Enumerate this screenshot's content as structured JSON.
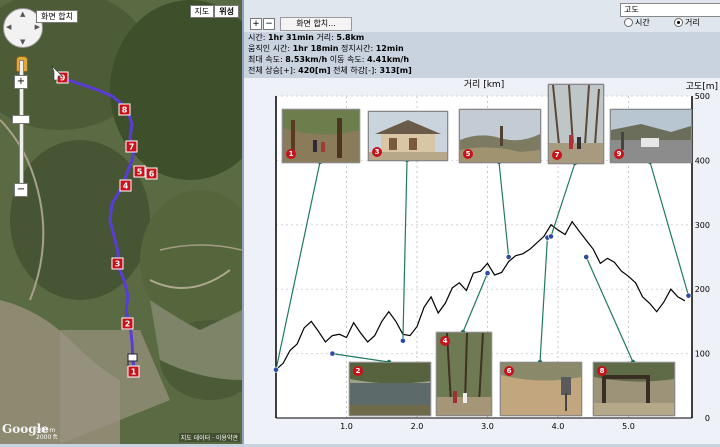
{
  "map": {
    "merge_button": "화면 합치",
    "type_map": "지도",
    "type_satellite": "위성",
    "logo": "Google",
    "scale_top": "500 m",
    "scale_bottom": "2000 ft",
    "attribution": "지도 데이터 · 이용약관",
    "markers": [
      "9",
      "8",
      "7",
      "6",
      "5",
      "4",
      "3",
      "2",
      "1"
    ]
  },
  "toolbar": {
    "plus": "+",
    "minus": "−",
    "merge_button": "화면 합치...",
    "series_select": "고도",
    "radio_time": "시간",
    "radio_distance": "거리",
    "radio_selected": "거리"
  },
  "stats": {
    "line1": [
      "시간: ",
      "1hr 31min",
      "  거리: ",
      "5.8km"
    ],
    "line2": [
      "움직인 시간: ",
      "1hr 18min",
      "  정지시간: ",
      "12min"
    ],
    "line3": [
      "최대 속도: ",
      "8.53km/h",
      "  이동 속도: ",
      "4.41km/h"
    ],
    "line4": [
      "전체 상승[+]: ",
      "420[m]",
      "  전체 하강[-]: ",
      "313[m]"
    ]
  },
  "chart_data": {
    "type": "line",
    "xlabel": "거리 [km]",
    "ylabel": "고도[m]",
    "x_ticks": [
      "1.0",
      "2.0",
      "3.0",
      "4.0",
      "5.0"
    ],
    "y_ticks": [
      "0",
      "100",
      "200",
      "300",
      "400",
      "500"
    ],
    "xlim": [
      0,
      5.9
    ],
    "ylim": [
      0,
      500
    ],
    "grid": true,
    "series": [
      {
        "name": "고도",
        "x": [
          0.0,
          0.1,
          0.2,
          0.3,
          0.4,
          0.5,
          0.6,
          0.7,
          0.8,
          0.9,
          1.0,
          1.1,
          1.2,
          1.3,
          1.4,
          1.5,
          1.6,
          1.7,
          1.8,
          1.9,
          2.0,
          2.1,
          2.2,
          2.3,
          2.4,
          2.5,
          2.6,
          2.7,
          2.8,
          2.9,
          3.0,
          3.1,
          3.2,
          3.3,
          3.4,
          3.5,
          3.6,
          3.7,
          3.8,
          3.9,
          4.0,
          4.1,
          4.2,
          4.3,
          4.4,
          4.5,
          4.6,
          4.7,
          4.8,
          4.9,
          5.0,
          5.1,
          5.2,
          5.3,
          5.4,
          5.5,
          5.6,
          5.7,
          5.8
        ],
        "y": [
          75,
          85,
          105,
          115,
          140,
          150,
          135,
          118,
          128,
          130,
          125,
          148,
          132,
          118,
          128,
          150,
          165,
          150,
          130,
          128,
          142,
          172,
          188,
          163,
          178,
          202,
          210,
          198,
          225,
          228,
          240,
          222,
          226,
          243,
          252,
          255,
          262,
          272,
          282,
          300,
          292,
          285,
          305,
          290,
          276,
          262,
          240,
          248,
          242,
          228,
          220,
          210,
          188,
          178,
          165,
          180,
          200,
          188,
          182
        ],
        "photo_points": [
          {
            "n": "1",
            "x": 0.0,
            "y": 75
          },
          {
            "n": "2",
            "x": 0.8,
            "y": 100
          },
          {
            "n": "3",
            "x": 1.8,
            "y": 120
          },
          {
            "n": "4",
            "x": 3.0,
            "y": 225
          },
          {
            "n": "5",
            "x": 3.3,
            "y": 250
          },
          {
            "n": "6",
            "x": 3.85,
            "y": 280
          },
          {
            "n": "7",
            "x": 3.9,
            "y": 282
          },
          {
            "n": "8",
            "x": 4.4,
            "y": 250
          },
          {
            "n": "9",
            "x": 5.85,
            "y": 190
          }
        ]
      }
    ]
  },
  "photos": [
    {
      "n": "1",
      "desc": "hikers on trail"
    },
    {
      "n": "3",
      "desc": "traditional house"
    },
    {
      "n": "5",
      "desc": "mountain view"
    },
    {
      "n": "7",
      "desc": "hikers under trees"
    },
    {
      "n": "9",
      "desc": "road with car"
    },
    {
      "n": "2",
      "desc": "lake"
    },
    {
      "n": "4",
      "desc": "hikers in forest"
    },
    {
      "n": "6",
      "desc": "dirt path with sign"
    },
    {
      "n": "8",
      "desc": "trail gate"
    }
  ],
  "colors": {
    "line": "#000000",
    "connector": "#1f7a5f",
    "marker": "#c8121b",
    "route": "#5a3cd6",
    "chart_bg": "#ffffff"
  }
}
